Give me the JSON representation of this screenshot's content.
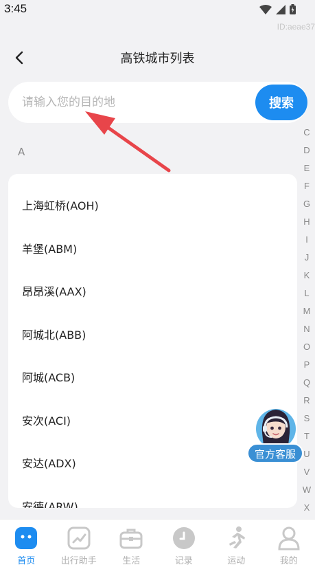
{
  "status_bar": {
    "time": "3:45",
    "watermark": "ID:aeae37"
  },
  "header": {
    "title": "高铁城市列表"
  },
  "search": {
    "placeholder": "请输入您的目的地",
    "button_label": "搜索"
  },
  "section": {
    "letter": "A"
  },
  "stations": [
    "上海虹桥(AOH)",
    "羊堡(ABM)",
    "昂昂溪(AAX)",
    "阿城北(ABB)",
    "阿城(ACB)",
    "安次(ACI)",
    "安达(ADX)",
    "安德(ARW)"
  ],
  "alpha_index": [
    "C",
    "D",
    "E",
    "F",
    "G",
    "H",
    "I",
    "J",
    "K",
    "L",
    "M",
    "N",
    "O",
    "P",
    "Q",
    "R",
    "S",
    "T",
    "U",
    "V",
    "W",
    "X"
  ],
  "customer_service": {
    "label": "官方客服"
  },
  "tabs": [
    {
      "label": "首页",
      "icon": "home-icon",
      "active": true
    },
    {
      "label": "出行助手",
      "icon": "chart-icon",
      "active": false
    },
    {
      "label": "生活",
      "icon": "briefcase-icon",
      "active": false
    },
    {
      "label": "记录",
      "icon": "clock-icon",
      "active": false
    },
    {
      "label": "运动",
      "icon": "running-icon",
      "active": false
    },
    {
      "label": "我的",
      "icon": "user-icon",
      "active": false
    }
  ],
  "colors": {
    "accent": "#1d8cf0",
    "annotation_arrow": "#e8454a"
  }
}
